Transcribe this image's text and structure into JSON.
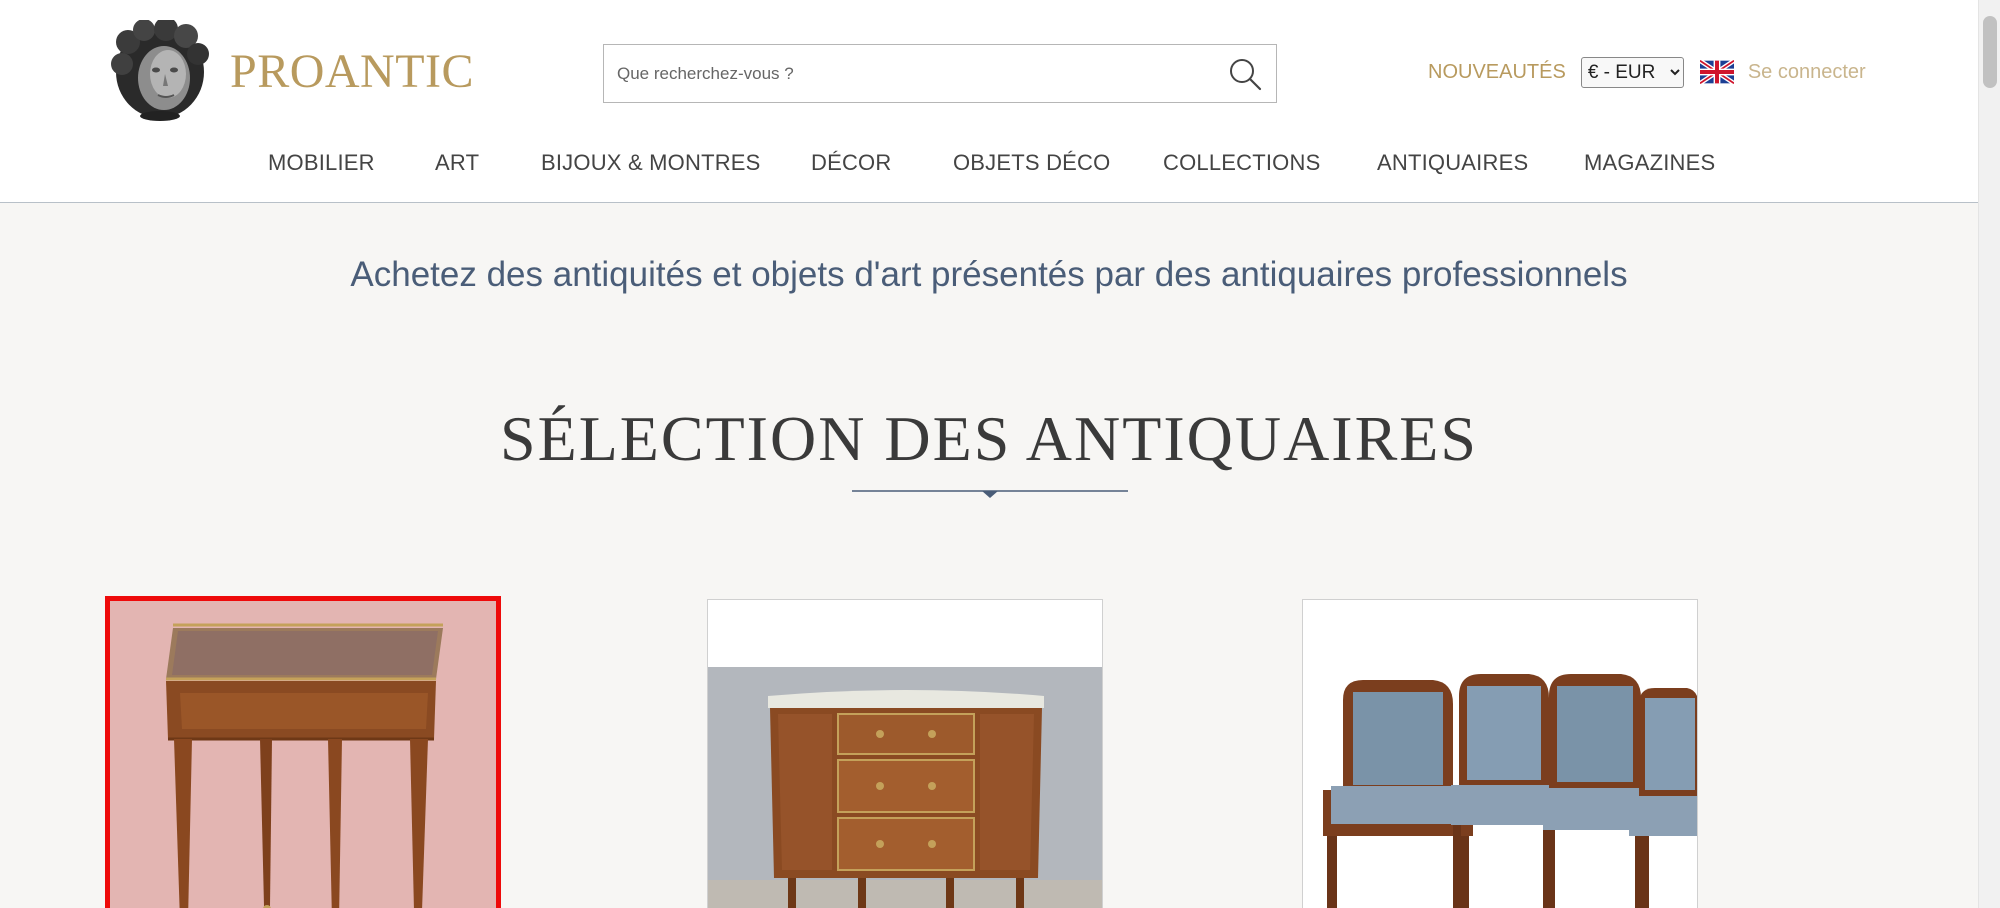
{
  "brand": {
    "name": "PROANTIC",
    "logo_icon": "cherub-head-logo",
    "gold_color": "#b89a5e"
  },
  "search": {
    "placeholder": "Que recherchez-vous ?",
    "icon": "search-icon"
  },
  "header_links": {
    "new_label": "NOUVEAUTÉS",
    "currency_selected": "€ - EUR",
    "currency_options": [
      "€ - EUR"
    ],
    "language_icon": "uk-flag-icon",
    "login_label": "Se connecter"
  },
  "nav": {
    "items": [
      {
        "label": "MOBILIER"
      },
      {
        "label": "ART"
      },
      {
        "label": "BIJOUX & MONTRES"
      },
      {
        "label": "DÉCOR"
      },
      {
        "label": "OBJETS DÉCO"
      },
      {
        "label": "COLLECTIONS"
      },
      {
        "label": "ANTIQUAIRES"
      },
      {
        "label": "MAGAZINES"
      }
    ]
  },
  "main": {
    "tagline": "Achetez des antiquités et objets d'art présentés par des antiquaires professionnels",
    "section_title": "SÉLECTION DES ANTIQUAIRES",
    "tagline_color": "#4a5d78",
    "products": [
      {
        "image": "side-table-marble-top",
        "selected": true
      },
      {
        "image": "demilune-commode-marquetry",
        "selected": false
      },
      {
        "image": "pair-of-empire-armchairs-blue",
        "selected": false
      }
    ],
    "highlight_color": "#ee0a0a"
  }
}
